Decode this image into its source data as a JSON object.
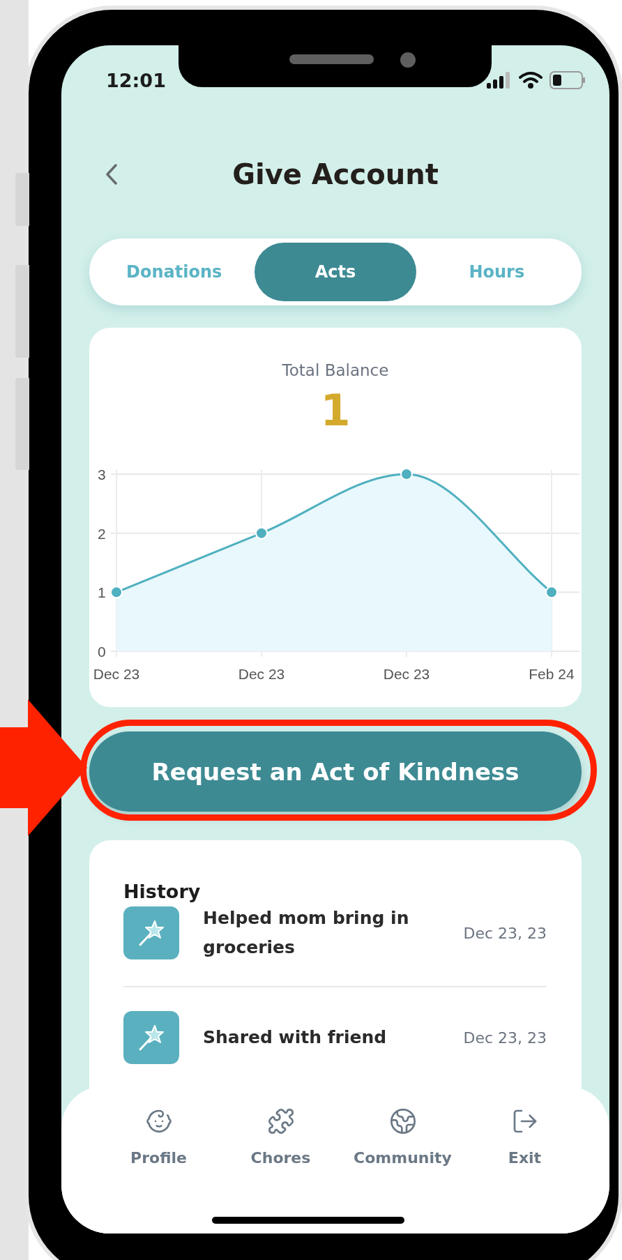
{
  "status_bar": {
    "time": "12:01"
  },
  "header": {
    "title": "Give Account"
  },
  "tabs": [
    {
      "label": "Donations",
      "selected": false
    },
    {
      "label": "Acts",
      "selected": true
    },
    {
      "label": "Hours",
      "selected": false
    }
  ],
  "balance_card": {
    "label": "Total Balance",
    "value": "1",
    "chart_data": {
      "type": "area",
      "categories": [
        "Dec 23",
        "Dec 23",
        "Dec 23",
        "Feb 24"
      ],
      "series": [
        {
          "color": "#4fb0bf",
          "values": [
            1,
            2,
            3,
            1
          ]
        }
      ],
      "ylim": [
        0,
        3
      ],
      "yticks": [
        0,
        1,
        2,
        3
      ],
      "grid": true
    }
  },
  "action_button": {
    "label": "Request an Act of Kindness"
  },
  "history": {
    "title": "History",
    "items": [
      {
        "text": "Helped mom bring in groceries",
        "date": "Dec 23, 23"
      },
      {
        "text": "Shared with friend",
        "date": "Dec 23, 23"
      }
    ]
  },
  "nav": [
    {
      "label": "Profile",
      "kind": "profile"
    },
    {
      "label": "Chores",
      "kind": "chores"
    },
    {
      "label": "Community",
      "kind": "community"
    },
    {
      "label": "Exit",
      "kind": "exit"
    }
  ]
}
